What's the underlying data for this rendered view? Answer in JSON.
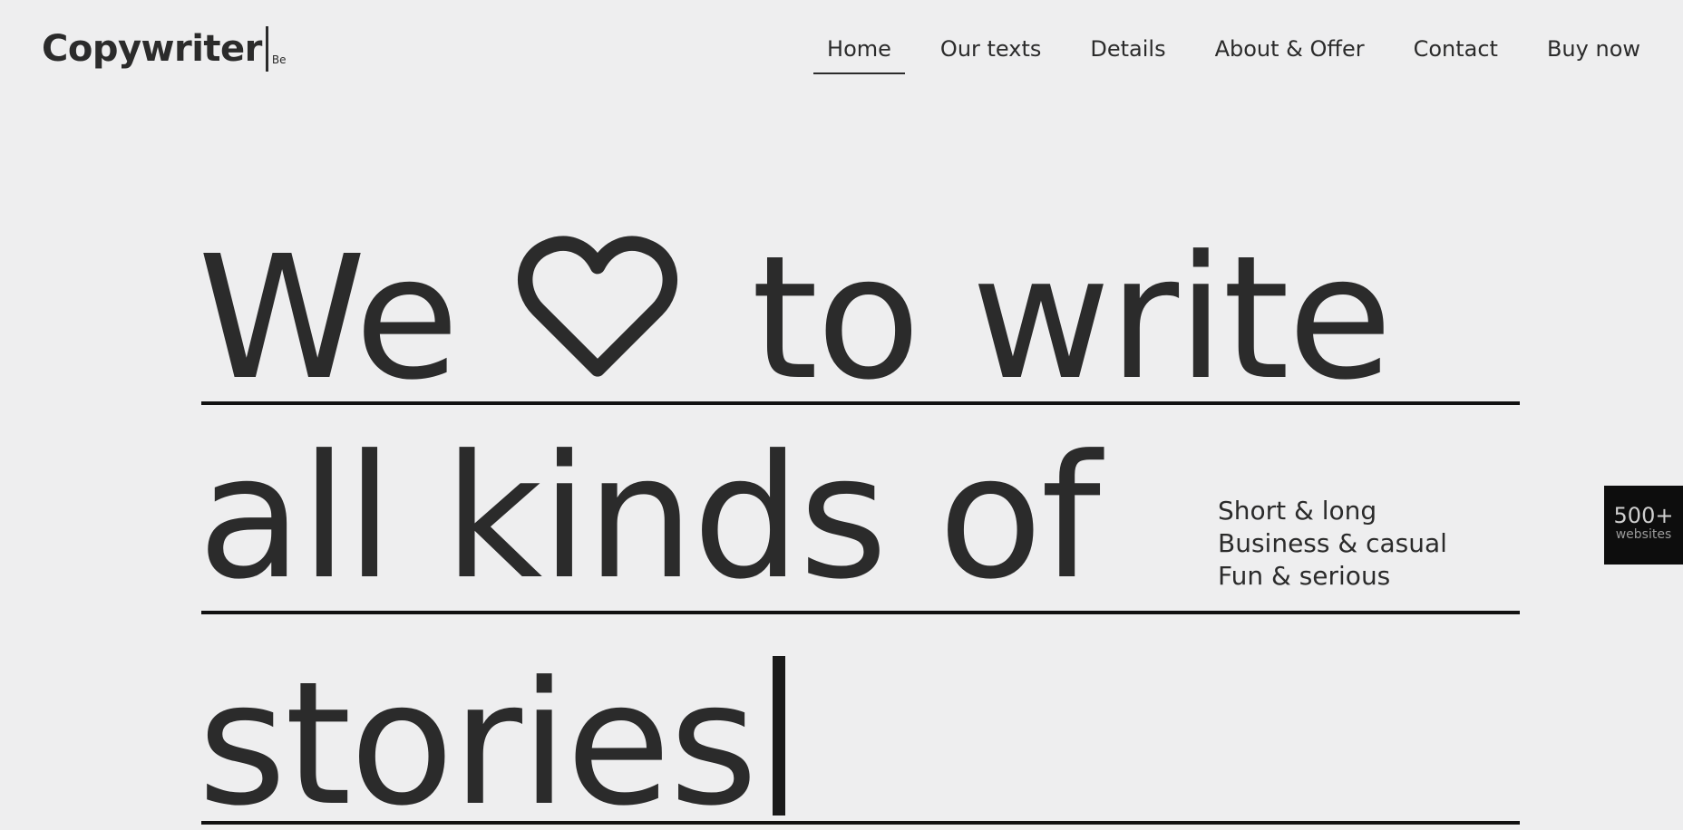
{
  "header": {
    "logo": "Copywriter",
    "logo_sub": "Be",
    "nav": [
      {
        "label": "Home",
        "active": true
      },
      {
        "label": "Our texts",
        "active": false
      },
      {
        "label": "Details",
        "active": false
      },
      {
        "label": "About & Offer",
        "active": false
      },
      {
        "label": "Contact",
        "active": false
      },
      {
        "label": "Buy now",
        "active": false
      }
    ]
  },
  "hero": {
    "line1_before": "We",
    "line1_icon": "heart-icon",
    "line1_after": "to write",
    "line2": "all kinds of",
    "line3": "stories",
    "side_items": [
      "Short & long",
      "Business & casual",
      "Fun & serious"
    ]
  },
  "badge": {
    "count": "500+",
    "label": "websites"
  },
  "colors": {
    "background": "#eeeeef",
    "text": "#2b2b2b",
    "rule": "#111111",
    "badge_bg": "#0d0d0d"
  }
}
